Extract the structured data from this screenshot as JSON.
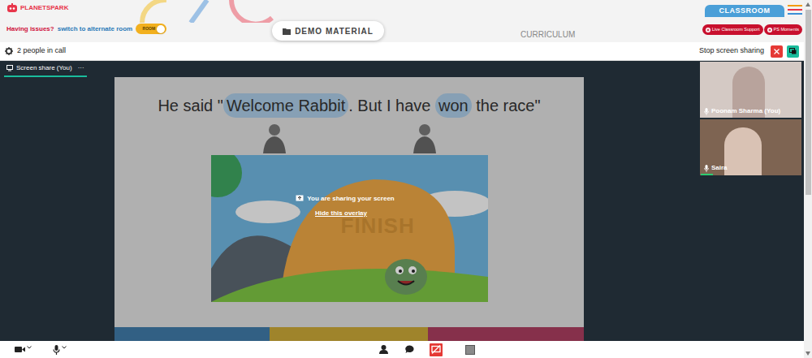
{
  "logo": "PLANETSPARK",
  "alert": {
    "text": "Having issues?",
    "link": "switch to alternate room",
    "toggle_label": "ROOM",
    "toggle_on": true
  },
  "tabs": [
    {
      "label": "DEMO MATERIAL",
      "selected": true
    },
    {
      "label": "CURRICULUM",
      "selected": false
    }
  ],
  "mode_tab": {
    "label": "CLASSROOM",
    "selected": true
  },
  "header_buttons": [
    "Live Classroom Support",
    "PS Moments"
  ],
  "call": {
    "people": "2 people in call",
    "stop": "Stop screen sharing"
  },
  "share_tab": {
    "label": "Screen share (You)",
    "menu": "···",
    "selected": true
  },
  "slide": {
    "parts": [
      {
        "text": "He said \"",
        "highlight": false
      },
      {
        "text": "Welcome Rabbit",
        "highlight": true
      },
      {
        "text": ". But I have ",
        "highlight": false
      },
      {
        "text": "won",
        "highlight": true
      },
      {
        "text": " the race\"",
        "highlight": false
      }
    ],
    "image_text": "FINISH"
  },
  "overlay": {
    "message": "You are sharing your screen",
    "link": "Hide this overlay"
  },
  "participants": [
    {
      "name": "Poonam Sharma (You)",
      "speaking": false
    },
    {
      "name": "Saira",
      "speaking": true
    }
  ],
  "toolbar": {
    "screen_share_active": true
  }
}
